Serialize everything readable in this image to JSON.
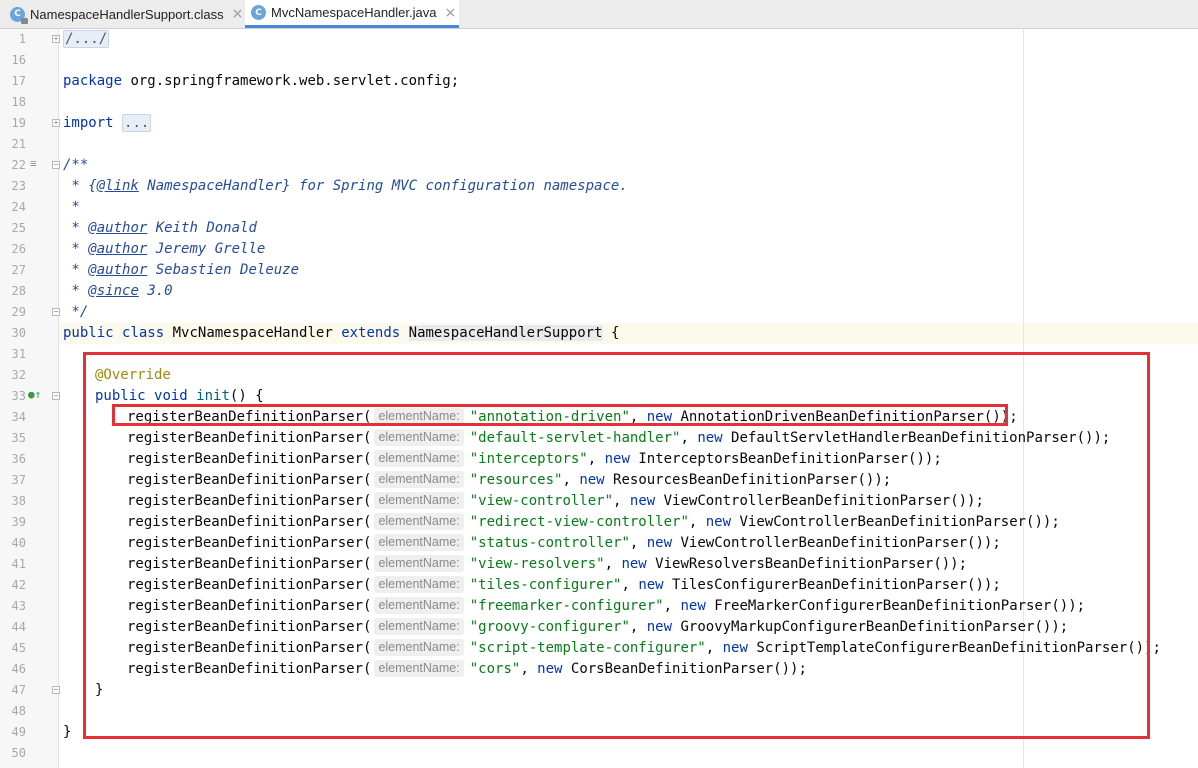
{
  "tabs": [
    {
      "label": "NamespaceHandlerSupport.class",
      "icon": "class-icon",
      "active": false
    },
    {
      "label": "MvcNamespaceHandler.java",
      "icon": "class-icon",
      "active": true
    }
  ],
  "gutter": {
    "line_numbers": [
      "1",
      "16",
      "17",
      "18",
      "19",
      "21",
      "22",
      "23",
      "24",
      "25",
      "26",
      "27",
      "28",
      "29",
      "30",
      "31",
      "32",
      "33",
      "34",
      "35",
      "36",
      "37",
      "38",
      "39",
      "40",
      "41",
      "42",
      "43",
      "44",
      "45",
      "46",
      "47",
      "48",
      "49",
      "50"
    ]
  },
  "code": {
    "fold_header": "/.../",
    "package_kw": "package",
    "package_name": " org.springframework.web.servlet.config;",
    "import_kw": "import",
    "import_fold": "...",
    "doc_open": "/**",
    "doc_line1_star": " * {",
    "doc_line1_link": "@link",
    "doc_line1_rest": " NamespaceHandler} for Spring MVC configuration namespace.",
    "doc_empty": " *",
    "author_tag": "@author",
    "authors": [
      " Keith Donald",
      " Jeremy Grelle",
      " Sebastien Deleuze"
    ],
    "since_tag": "@since",
    "since_value": " 3.0",
    "doc_close": " */",
    "class_public": "public",
    "class_kw": "class",
    "class_name": " MvcNamespaceHandler ",
    "extends_kw": "extends",
    "parent_class": "NamespaceHandlerSupport",
    "class_brace": " {",
    "override": "@Override",
    "method_public": "public",
    "method_void": "void",
    "method_name": "init",
    "method_rest": "() {",
    "call_name": "registerBeanDefinitionParser(",
    "hint_label": "elementName:",
    "new_kw": "new",
    "registrations": [
      {
        "key": "\"annotation-driven\"",
        "parser": " AnnotationDrivenBeanDefinitionParser());"
      },
      {
        "key": "\"default-servlet-handler\"",
        "parser": " DefaultServletHandlerBeanDefinitionParser());"
      },
      {
        "key": "\"interceptors\"",
        "parser": " InterceptorsBeanDefinitionParser());"
      },
      {
        "key": "\"resources\"",
        "parser": " ResourcesBeanDefinitionParser());"
      },
      {
        "key": "\"view-controller\"",
        "parser": " ViewControllerBeanDefinitionParser());"
      },
      {
        "key": "\"redirect-view-controller\"",
        "parser": " ViewControllerBeanDefinitionParser());"
      },
      {
        "key": "\"status-controller\"",
        "parser": " ViewControllerBeanDefinitionParser());"
      },
      {
        "key": "\"view-resolvers\"",
        "parser": " ViewResolversBeanDefinitionParser());"
      },
      {
        "key": "\"tiles-configurer\"",
        "parser": " TilesConfigurerBeanDefinitionParser());"
      },
      {
        "key": "\"freemarker-configurer\"",
        "parser": " FreeMarkerConfigurerBeanDefinitionParser());"
      },
      {
        "key": "\"groovy-configurer\"",
        "parser": " GroovyMarkupConfigurerBeanDefinitionParser());"
      },
      {
        "key": "\"script-template-configurer\"",
        "parser": " ScriptTemplateConfigurerBeanDefinitionParser());"
      },
      {
        "key": "\"cors\"",
        "parser": " CorsBeanDefinitionParser());"
      }
    ],
    "method_close": "}",
    "class_close": "}"
  },
  "colors": {
    "keyword": "#0033b3",
    "string": "#067d17",
    "javadoc": "#264b9c",
    "annotation": "#9e880d",
    "annotation_box": "#e3313a"
  }
}
